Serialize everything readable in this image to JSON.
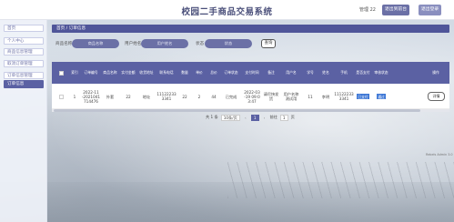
{
  "header": {
    "site_title": "校园二手商品交易系统",
    "user_label": "管理 22",
    "btn_front": "退出到前台",
    "btn_logout": "退出登录"
  },
  "sidebar": {
    "items": [
      {
        "label": "首页"
      },
      {
        "label": "个人中心"
      },
      {
        "label": "商品信息管理"
      },
      {
        "label": "取消订单管理"
      },
      {
        "label": "订单信息管理"
      }
    ],
    "active_sub": "订单信息"
  },
  "breadcrumb": {
    "home": "首页",
    "sep": "/",
    "current": "订单信息"
  },
  "search": {
    "label1": "商品名称",
    "placeholder1": "商品名称",
    "label2": "用户姓名",
    "placeholder2": "用户姓名",
    "label3": "状态",
    "placeholder3": "状态",
    "button": "查询"
  },
  "table": {
    "headers": [
      "索引",
      "订单编号",
      "商品名称",
      "实付金额",
      "收货地址",
      "联系电话",
      "数量",
      "单价",
      "总价",
      "订单状态",
      "支付时间",
      "备注",
      "用户名",
      "学号",
      "姓名",
      "手机",
      "是否支付",
      "审核状态",
      "操作"
    ],
    "row": {
      "index": "1",
      "order_no": "2022-11\n-2021041\n714476",
      "product": "外套",
      "paid": "22",
      "address": "地址",
      "phone": "11122233\n3341",
      "qty": "22",
      "unit_price": "2",
      "total": "44",
      "status": "已完成",
      "pay_time": "2022-03\n-19 09:0\n3:47",
      "note": "请尽快发货",
      "username": "用户名称\n测试用",
      "student_no": "11",
      "name": "李明",
      "mobile": "11122233\n3341",
      "is_paid": "已支付",
      "review": "通过",
      "action": "详情"
    }
  },
  "pager": {
    "total": "共 1 条",
    "page_size": "10条/页",
    "prev": "‹",
    "page": "1",
    "next": "›",
    "goto_label": "前往",
    "goto_value": "1",
    "goto_unit": "页"
  },
  "footer_note": "Rebels Admin 3.0"
}
